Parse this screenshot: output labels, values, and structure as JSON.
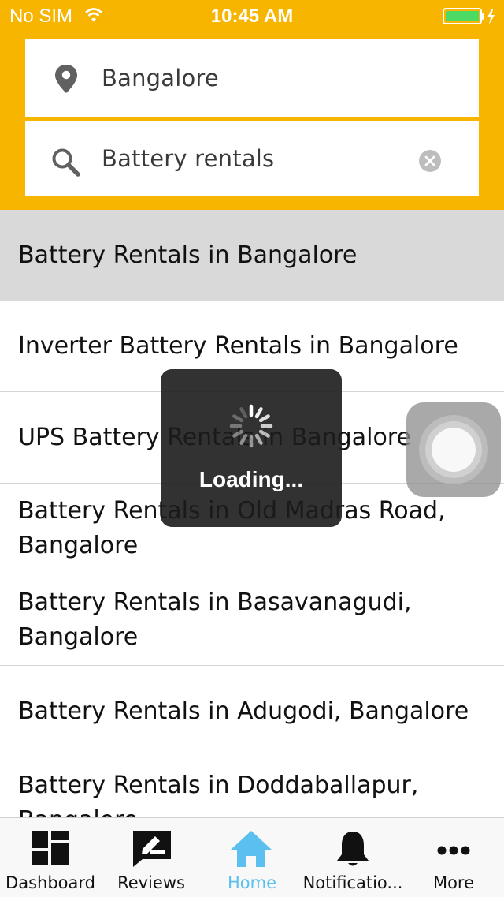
{
  "status_bar": {
    "carrier": "No SIM",
    "time": "10:45 AM",
    "battery_color": "#4cd964"
  },
  "search": {
    "location_value": "Bangalore",
    "query_value": "Battery rentals"
  },
  "results": [
    {
      "text": "Battery Rentals in Bangalore"
    },
    {
      "text": "Inverter Battery Rentals in Bangalore"
    },
    {
      "text": "UPS Battery Rentals in Bangalore"
    },
    {
      "text": "Battery Rentals in Old Madras Road, Bangalore"
    },
    {
      "text": "Battery Rentals in Basavanagudi, Bangalore"
    },
    {
      "text": "Battery Rentals in Adugodi, Bangalore"
    },
    {
      "text": "Battery Rentals in Doddaballapur, Bangalore"
    }
  ],
  "loading": {
    "label": "Loading..."
  },
  "tabs": [
    {
      "label": "Dashboard",
      "icon": "dashboard-icon"
    },
    {
      "label": "Reviews",
      "icon": "reviews-icon"
    },
    {
      "label": "Home",
      "icon": "home-icon"
    },
    {
      "label": "Notificatio...",
      "icon": "bell-icon"
    },
    {
      "label": "More",
      "icon": "more-icon"
    }
  ],
  "colors": {
    "header": "#f7b500",
    "active_tab": "#5bc0f0",
    "selected_row": "#d9d9d9"
  }
}
